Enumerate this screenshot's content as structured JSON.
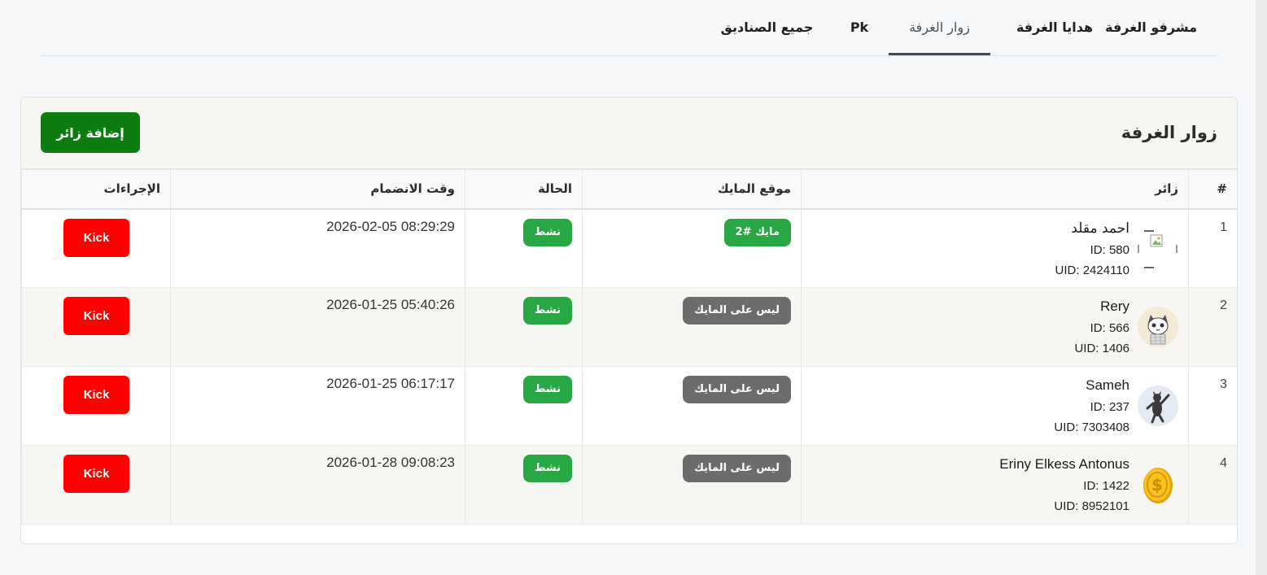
{
  "tabs": [
    {
      "label": "مشرفو الغرفة"
    },
    {
      "label": "هدايا الغرفة"
    },
    {
      "label": "زوار الغرفة"
    },
    {
      "label": "Pk"
    },
    {
      "label": "جميع الصناديق"
    }
  ],
  "card": {
    "title": "زوار الغرفة",
    "add_button": "إضافة زائر"
  },
  "table": {
    "headers": {
      "num": "#",
      "visitor": "زائر",
      "mic": "موقع المايك",
      "status": "الحالة",
      "joined": "وقت الانضمام",
      "actions": "الإجراءات"
    },
    "rows": [
      {
        "num": "1",
        "name": "احمد مقلد",
        "id": "ID: 580",
        "uid": "UID: 2424110",
        "mic": "مايك #2",
        "mic_on": true,
        "status": "نشط",
        "joined": "2026-02-05 08:29:29",
        "action": "Kick",
        "avatar": "broken-image"
      },
      {
        "num": "2",
        "name": "Rery",
        "id": "ID: 566",
        "uid": "UID: 1406",
        "mic": "ليس على المايك",
        "mic_on": false,
        "status": "نشط",
        "joined": "2026-01-25 05:40:26",
        "action": "Kick",
        "avatar": "cat-avatar"
      },
      {
        "num": "3",
        "name": "Sameh",
        "id": "ID: 237",
        "uid": "UID: 7303408",
        "mic": "ليس على المايك",
        "mic_on": false,
        "status": "نشط",
        "joined": "2026-01-25 06:17:17",
        "action": "Kick",
        "avatar": "dancing-cat-avatar"
      },
      {
        "num": "4",
        "name": "Eriny Elkess Antonus",
        "id": "ID: 1422",
        "uid": "UID: 8952101",
        "mic": "ليس على المايك",
        "mic_on": false,
        "status": "نشط",
        "joined": "2026-01-28 09:08:23",
        "action": "Kick",
        "avatar": "coin-avatar"
      }
    ]
  },
  "colors": {
    "add_button": "#0d7d12",
    "badge_green": "#28a745",
    "badge_grey": "#6c6c6c",
    "kick": "#ff0000"
  }
}
